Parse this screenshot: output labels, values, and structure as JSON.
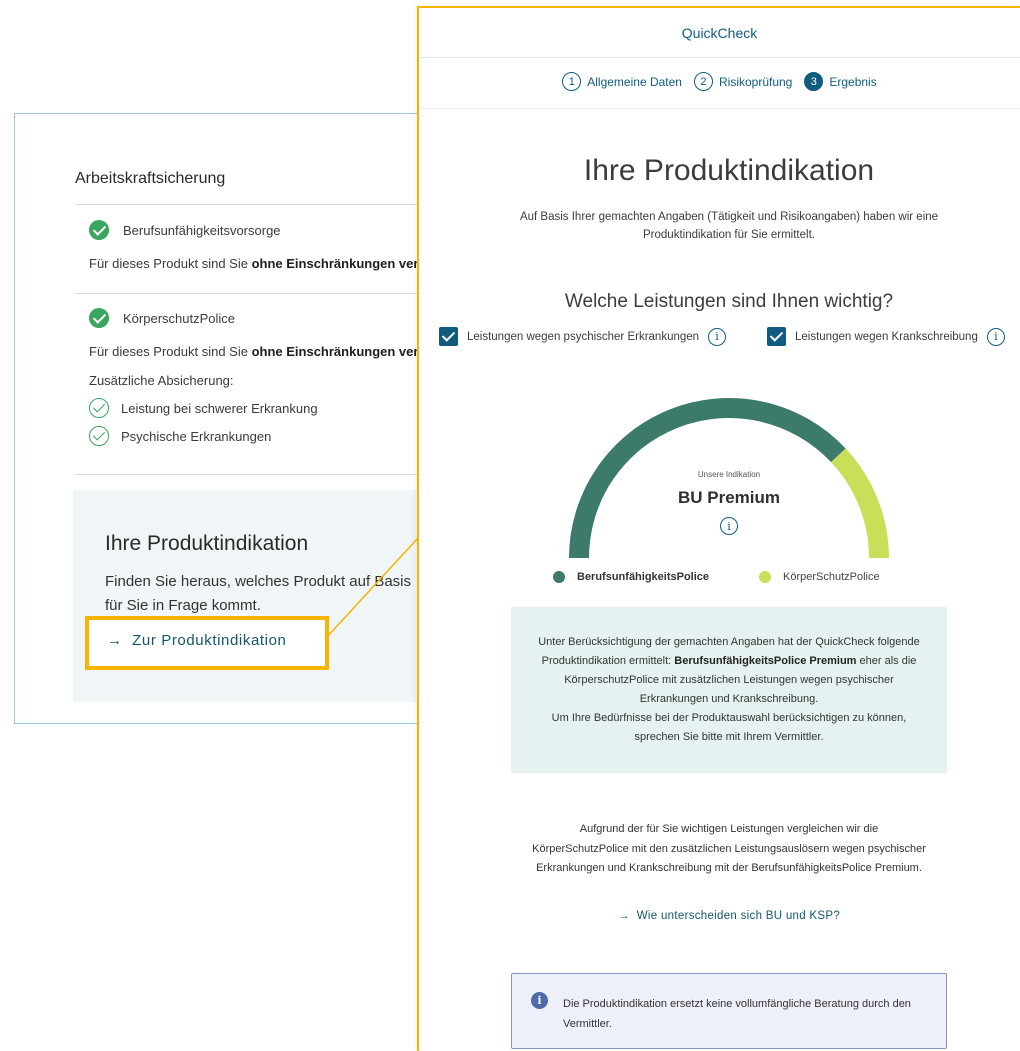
{
  "left_card": {
    "section_title": "Arbeitskraftsicherung",
    "products": [
      {
        "name": "Berufsunfähigkeitsvorsorge",
        "text_prefix": "Für dieses Produkt sind Sie ",
        "text_bold": "ohne Einschränkungen ver"
      },
      {
        "name": "KörperschutzPolice",
        "text_prefix": "Für dieses Produkt sind Sie ",
        "text_bold": "ohne Einschränkungen ver"
      }
    ],
    "extra_label": "Zusätzliche Absicherung:",
    "extras": [
      "Leistung bei schwerer Erkrankung",
      "Psychische Erkrankungen"
    ],
    "cta": {
      "title": "Ihre Produktindikation",
      "text": "Finden Sie heraus, welches Produkt auf Basis für Sie in Frage kommt.",
      "link_arrow": "→",
      "link_label": "Zur Produktindikation"
    }
  },
  "modal": {
    "title": "QuickCheck",
    "steps": [
      {
        "num": "1",
        "label": "Allgemeine Daten",
        "active": false
      },
      {
        "num": "2",
        "label": "Risikoprüfung",
        "active": false
      },
      {
        "num": "3",
        "label": "Ergebnis",
        "active": true
      }
    ],
    "heading": "Ihre Produktindikation",
    "subheading": "Auf Basis Ihrer gemachten Angaben (Tätigkeit und Risikoangaben) haben wir eine Produktindikation für Sie ermittelt.",
    "question": "Welche Leistungen sind Ihnen wichtig?",
    "checkboxes": [
      {
        "label": "Leistungen wegen psychischer Erkrankungen",
        "checked": true
      },
      {
        "label": "Leistungen wegen Krankschreibung",
        "checked": true
      }
    ],
    "gauge": {
      "caption": "Unsere Indikation",
      "value": "BU Premium",
      "segments": [
        {
          "name": "BerufsunfähigkeitsPolice",
          "share": 0.76,
          "color": "#3c7a6b"
        },
        {
          "name": "KörperSchutzPolice",
          "share": 0.24,
          "color": "#c8df5a"
        }
      ]
    },
    "legend": [
      {
        "label": "BerufsunfähigkeitsPolice",
        "color": "#3c7a6b"
      },
      {
        "label": "KörperSchutzPolice",
        "color": "#c8df5a"
      }
    ],
    "result": {
      "part1": "Unter Berücksichtigung der gemachten Angaben hat der QuickCheck folgende Produktindikation ermittelt: ",
      "bold": "BerufsunfähigkeitsPolice Premium",
      "part2": " eher als die KörperschutzPolice mit zusätzlichen Leistungen wegen psychischer Erkrankungen und Krankschreibung.",
      "part3": "Um Ihre Bedürfnisse bei der Produktauswahl berücksichtigen zu können, sprechen Sie bitte mit Ihrem Vermittler."
    },
    "compare_text": "Aufgrund der für Sie wichtigen Leistungen vergleichen wir die KörperSchutzPolice mit den zusätzlichen Leistungsauslösern wegen psychischer Erkrankungen und Krankschreibung mit der BerufsunfähigkeitsPolice Premium.",
    "compare_link_arrow": "→",
    "compare_link": "Wie unterscheiden sich BU und KSP?",
    "note": "Die Produktindikation ersetzt keine vollumfängliche Beratung durch den Vermittler."
  },
  "colors": {
    "primary": "#0f5c80",
    "highlight": "#f4b400",
    "success": "#3aa55d",
    "gauge_dark": "#3c7a6b",
    "gauge_light": "#c8df5a"
  }
}
